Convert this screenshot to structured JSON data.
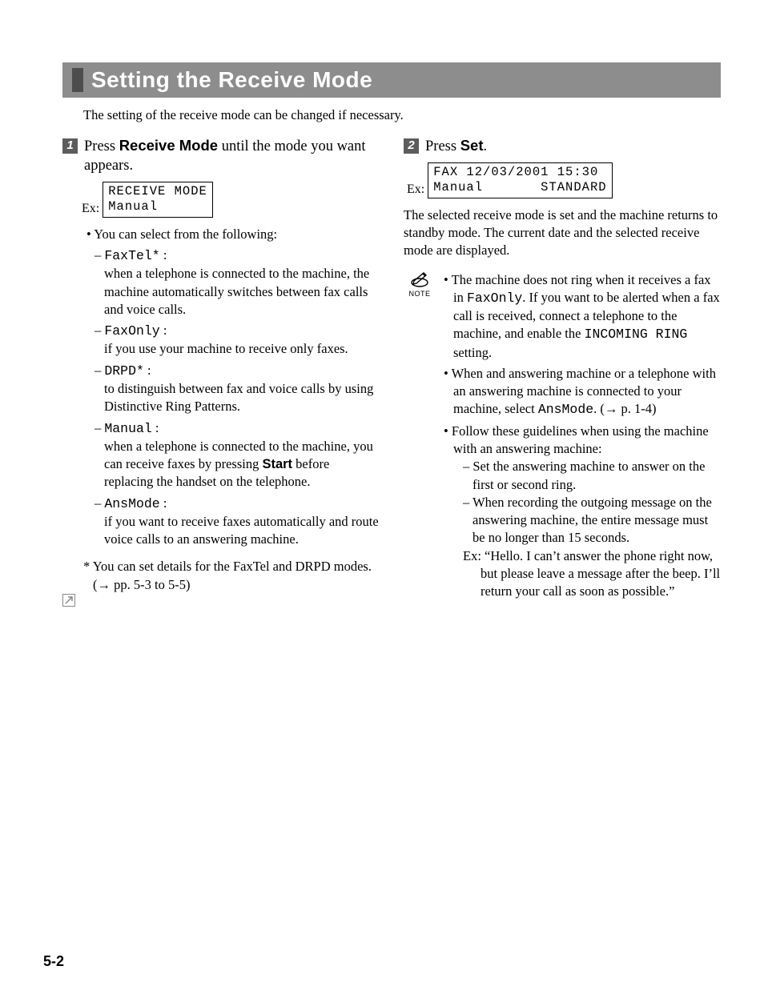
{
  "heading": "Setting the Receive Mode",
  "intro": "The setting of the receive mode can be changed if necessary.",
  "step1": {
    "num": "1",
    "pre": "Press ",
    "key": "Receive Mode",
    "post": " until the mode you want appears.",
    "ex_label": "Ex:",
    "lcd": "RECEIVE MODE\nManual",
    "select_intro": "You can select from the following:",
    "options": [
      {
        "name": "FaxTel*",
        "colon": " :",
        "desc": "when a telephone is connected to the machine, the machine automatically switches between fax calls and voice calls."
      },
      {
        "name": "FaxOnly",
        "colon": " :",
        "desc": "if you use your machine to receive only faxes."
      },
      {
        "name": "DRPD*",
        "colon": " :",
        "desc": "to distinguish between fax and voice calls by using Distinctive Ring Patterns."
      },
      {
        "name": "Manual",
        "colon": " :",
        "desc_pre": "when a telephone is connected to the machine, you can receive faxes by pressing ",
        "desc_key": "Start",
        "desc_post": " before replacing the handset on the telephone."
      },
      {
        "name": "AnsMode",
        "colon": " :",
        "desc": "if you want to receive faxes automatically and route voice calls to an answering machine."
      }
    ],
    "footnote": "* You can set details for the FaxTel and DRPD modes. (→ pp. 5-3 to 5-5)"
  },
  "step2": {
    "num": "2",
    "pre": "Press ",
    "key": "Set",
    "post": ".",
    "ex_label": "Ex:",
    "lcd": "FAX 12/03/2001 15:30\nManual       STANDARD",
    "result": "The selected receive mode is set and the machine returns to standby mode. The current date and the selected receive mode are displayed.",
    "note_label": "NOTE",
    "notes": {
      "n1_pre": "The machine does not ring when it receives a fax in ",
      "n1_code1": "FaxOnly",
      "n1_mid": ". If you want to be alerted when a fax call is received, connect a telephone to the machine, and enable the ",
      "n1_code2": "INCOMING RING",
      "n1_post": " setting.",
      "n2_pre": "When and answering machine or a telephone with an answering machine is connected to your machine, select ",
      "n2_code": "AnsMode",
      "n2_post": ". (→ p. 1-4)",
      "n3": "Follow these guidelines when using the machine with an answering machine:",
      "n3_sub1": "Set the answering machine to answer on the first or second ring.",
      "n3_sub2": "When recording the outgoing message on the answering machine, the entire message must be no longer than 15 seconds.",
      "n3_ex": "Ex: “Hello. I can’t answer the phone right now, but please leave a message after the beep. I’ll return your call as soon as possible.”"
    }
  },
  "page_number": "5-2"
}
